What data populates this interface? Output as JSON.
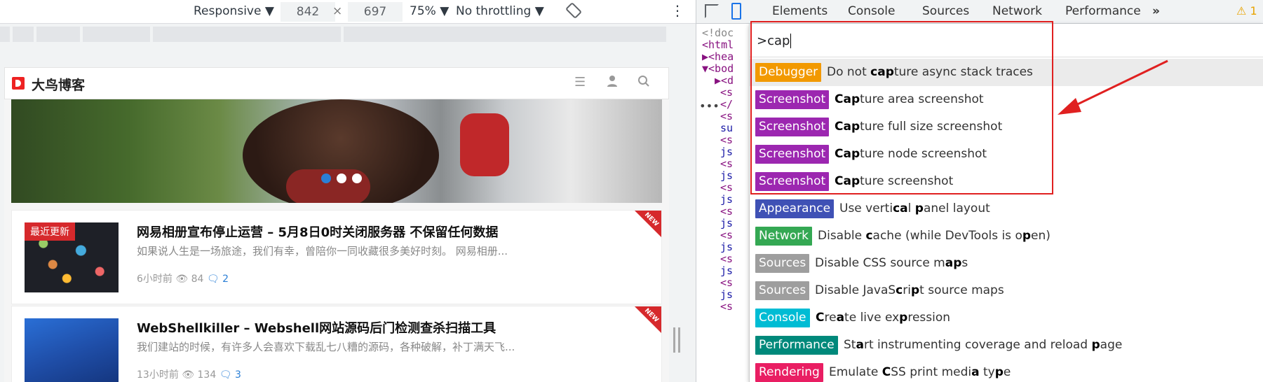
{
  "device_toolbar": {
    "mode": "Responsive ▼",
    "width": "842",
    "times": "×",
    "height": "697",
    "zoom": "75% ▼",
    "throttling": "No throttling ▼",
    "more": "⋮"
  },
  "site": {
    "name": "大鸟博客",
    "articles": [
      {
        "tag": "最近更新",
        "title": "网易相册宣布停止运营 – 5月8日0时关闭服务器 不保留任何数据",
        "excerpt": "如果说人生是一场旅途，我们有幸，曾陪你一同收藏很多美好时刻。   网易相册...",
        "time": "6小时前",
        "views": "84",
        "comments": "2",
        "badge": "NEW"
      },
      {
        "title": "WebShellkiller – Webshell网站源码后门检测查杀扫描工具",
        "excerpt": "我们建站的时候，有许多人会喜欢下载乱七八糟的源码，各种破解，补丁满天飞...",
        "time": "13小时前",
        "views": "134",
        "comments": "3",
        "badge": "NEW"
      }
    ]
  },
  "devtools": {
    "tabs": [
      "Elements",
      "Console",
      "Sources",
      "Network",
      "Performance",
      "»"
    ],
    "warning_count": "1",
    "dom_lines": [
      "<!doc",
      "<html",
      "▶<hea",
      "▼<bod",
      "▶<d",
      "<s",
      "</",
      "<s",
      "su",
      "<s",
      "js",
      "<s",
      "js",
      "<s",
      "js",
      "<s",
      "js",
      "<s",
      "js",
      "<s",
      "js",
      "<s",
      "js",
      "<s"
    ],
    "command_menu": {
      "query": ">cap",
      "items": [
        {
          "badge": "Debugger",
          "color": "#f29900",
          "pre": "Do not ",
          "bold": "cap",
          "post": "ture async stack traces"
        },
        {
          "badge": "Screenshot",
          "color": "#9c27b0",
          "pre": "",
          "bold": "Cap",
          "post": "ture area screenshot"
        },
        {
          "badge": "Screenshot",
          "color": "#9c27b0",
          "pre": "",
          "bold": "Cap",
          "post": "ture full size screenshot"
        },
        {
          "badge": "Screenshot",
          "color": "#9c27b0",
          "pre": "",
          "bold": "Cap",
          "post": "ture node screenshot"
        },
        {
          "badge": "Screenshot",
          "color": "#9c27b0",
          "pre": "",
          "bold": "Cap",
          "post": "ture screenshot"
        },
        {
          "badge": "Appearance",
          "color": "#3f51b5",
          "label": "Use verti<b>c</b><b>a</b>l <b>p</b>anel layout"
        },
        {
          "badge": "Network",
          "color": "#34a853",
          "label": "Disable <b>c</b>ache (while DevTools is o<b>p</b>en)"
        },
        {
          "badge": "Sources",
          "color": "#9e9e9e",
          "label": "Disable CSS source m<b>a</b><b>p</b>s"
        },
        {
          "badge": "Sources",
          "color": "#9e9e9e",
          "label": "Disable JavaS<b>c</b>ri<b>p</b>t source maps"
        },
        {
          "badge": "Console",
          "color": "#00bcd4",
          "label": "<b>C</b>re<b>a</b>te live ex<b>p</b>ression"
        },
        {
          "badge": "Performance",
          "color": "#00897b",
          "label": "St<b>a</b>rt instrumenting coverage and reload <b>p</b>age"
        },
        {
          "badge": "Rendering",
          "color": "#e91e63",
          "label": "Emulate <b>C</b>SS print medi<b>a</b> ty<b>p</b>e"
        }
      ]
    }
  }
}
